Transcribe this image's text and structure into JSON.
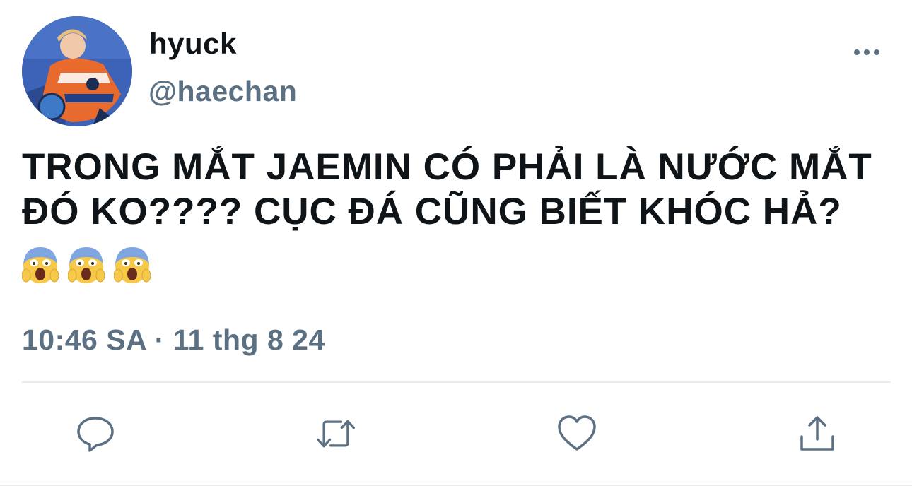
{
  "tweet": {
    "display_name": "hyuck",
    "handle": "@haechan",
    "text": "TRONG MẮT JAEMIN CÓ PHẢI LÀ NƯỚC MẮT ĐÓ KO???? CỤC ĐÁ CŨNG BIẾT KHÓC HẢ?",
    "emojis": [
      "😱",
      "😱",
      "😱"
    ],
    "timestamp": "10:46 SA · 11 thg 8 24"
  },
  "icons": {
    "more": "more-horizontal-icon",
    "reply": "reply-icon",
    "retweet": "retweet-icon",
    "like": "heart-icon",
    "share": "share-icon"
  },
  "colors": {
    "text_primary": "#0f1419",
    "text_secondary": "#5b7083",
    "icon": "#5b7083",
    "divider": "#e6ecf0"
  }
}
